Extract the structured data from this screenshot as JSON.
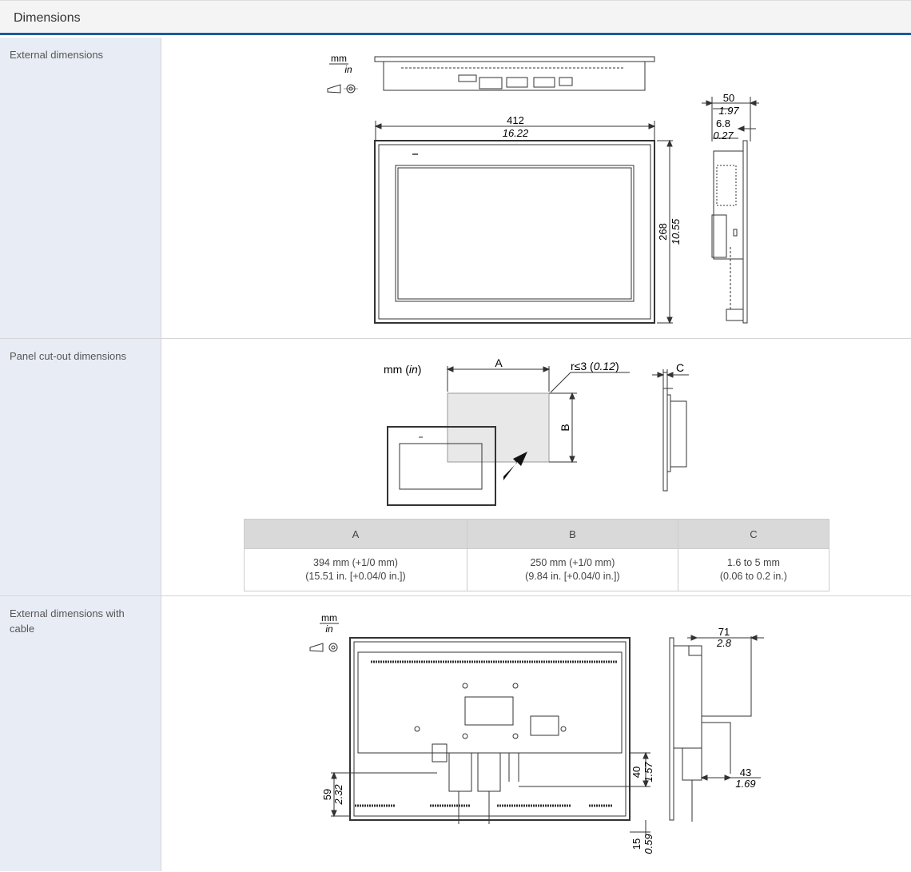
{
  "section_title": "Dimensions",
  "rows": [
    {
      "label": "External dimensions"
    },
    {
      "label": "Panel cut-out dimensions"
    },
    {
      "label": "External dimensions with cable"
    }
  ],
  "ext": {
    "unit_mm": "mm",
    "unit_in": "in",
    "width_mm": "412",
    "width_in": "16.22",
    "height_mm": "268",
    "height_in": "10.55",
    "depth_mm": "50",
    "depth_in": "1.97",
    "bezel_mm": "6.8",
    "bezel_in": "0.27"
  },
  "cutout": {
    "unit_label": "mm (",
    "unit_in": "in",
    "unit_close": ")",
    "a_label": "A",
    "b_label": "B",
    "c_label": "C",
    "radius_prefix": "r≤3 (",
    "radius_in": "0.12",
    "radius_suffix": ")",
    "table": {
      "headers": [
        "A",
        "B",
        "C"
      ],
      "cells": [
        [
          "394 mm (+1/0 mm)",
          "(15.51 in. [+0.04/0 in.])"
        ],
        [
          "250 mm (+1/0 mm)",
          "(9.84 in. [+0.04/0 in.])"
        ],
        [
          "1.6 to 5 mm",
          "(0.06 to 0.2 in.)"
        ]
      ]
    }
  },
  "cable": {
    "unit_mm": "mm",
    "unit_in": "in",
    "d59_mm": "59",
    "d59_in": "2.32",
    "d40_mm": "40",
    "d40_in": "1.57",
    "d15_mm": "15",
    "d15_in": "0.59",
    "d71_mm": "71",
    "d71_in": "2.8",
    "d43_mm": "43",
    "d43_in": "1.69"
  }
}
